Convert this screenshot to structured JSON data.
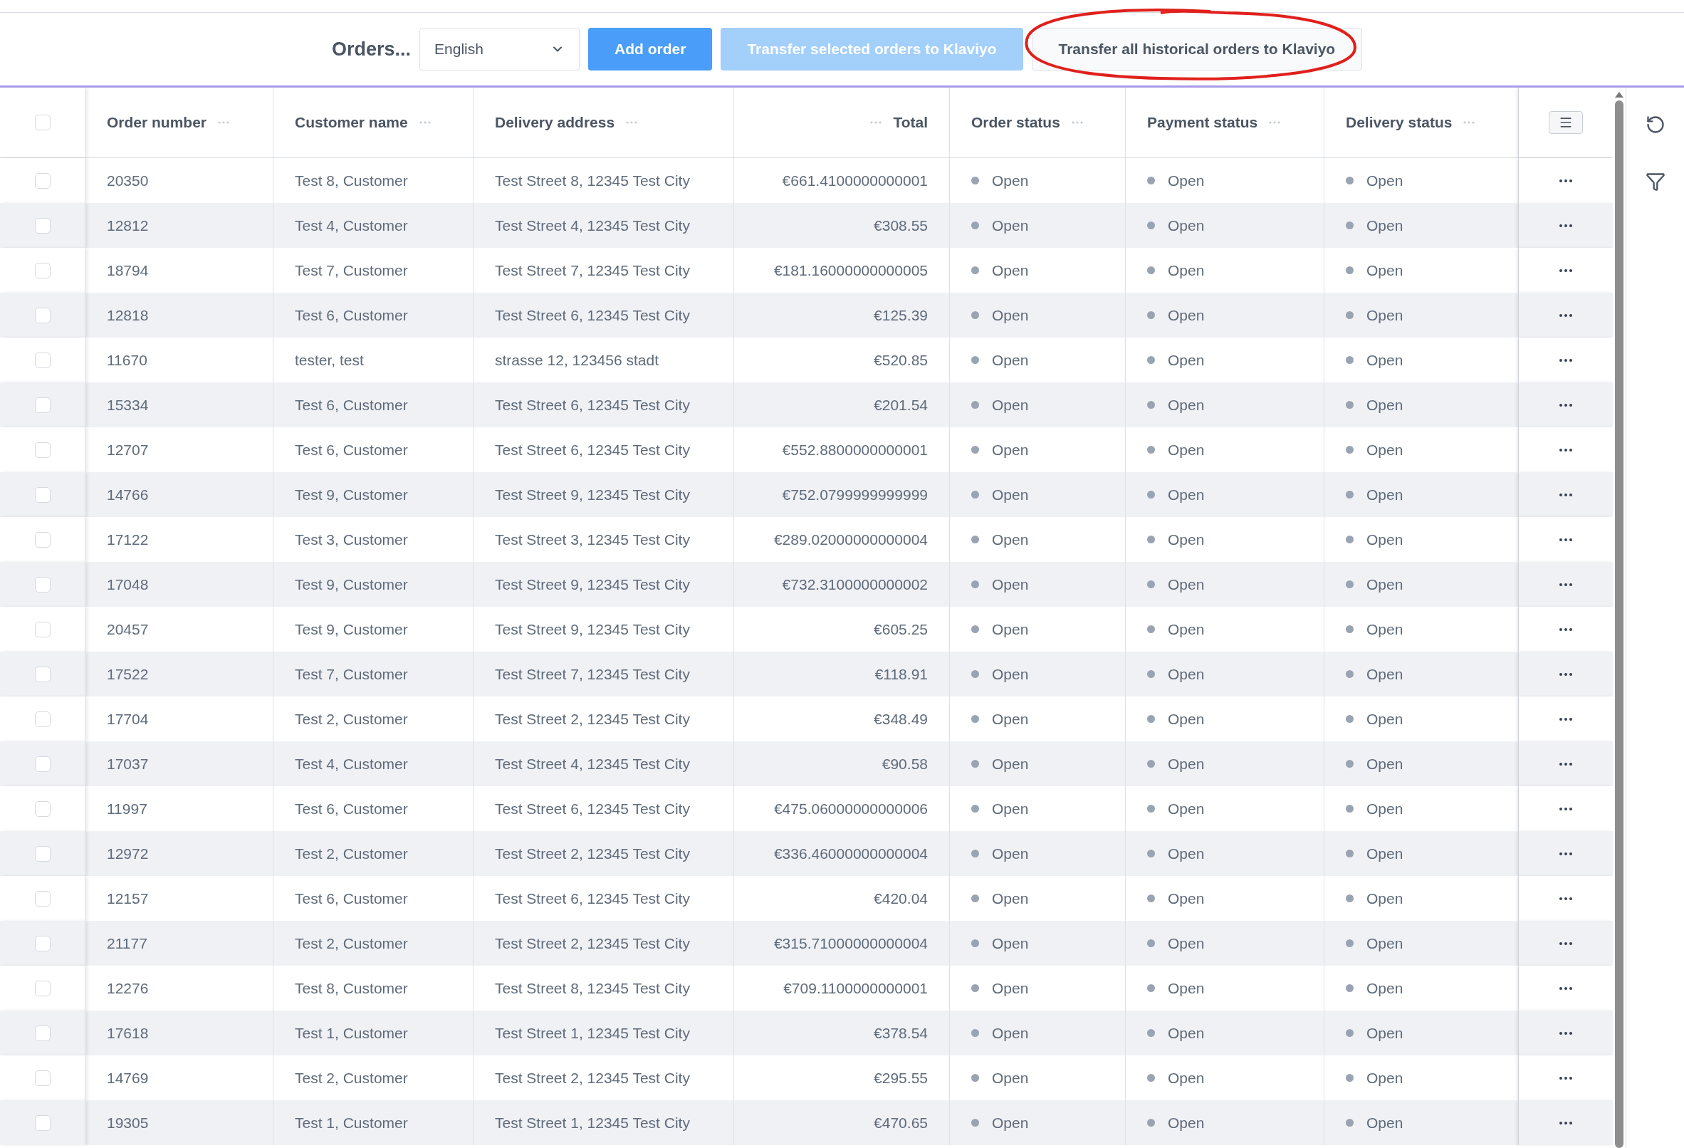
{
  "toolbar": {
    "title": "Orders...",
    "language_select": {
      "value": "English"
    },
    "buttons": [
      {
        "label": "Add order",
        "kind": "primary",
        "disabled": false
      },
      {
        "label": "Transfer selected orders to Klaviyo",
        "kind": "primary",
        "disabled": true
      },
      {
        "label": "Transfer all historical orders to Klaviyo",
        "kind": "secondary",
        "disabled": false
      }
    ]
  },
  "table": {
    "select_all": {
      "checked": false
    },
    "columns": [
      {
        "label": "Order number",
        "kind": "text"
      },
      {
        "label": "Customer name",
        "kind": "text"
      },
      {
        "label": "Delivery address",
        "kind": "text"
      },
      {
        "label": "Total",
        "kind": "amount"
      },
      {
        "label": "Order status",
        "kind": "status"
      },
      {
        "label": "Payment status",
        "kind": "status"
      },
      {
        "label": "Delivery status",
        "kind": "status"
      }
    ],
    "rows": [
      {
        "checked": false,
        "cells": [
          "20350",
          "Test 8, Customer",
          "Test Street 8, 12345 Test City",
          "€661.4100000000001",
          "Open",
          "Open",
          "Open"
        ]
      },
      {
        "checked": false,
        "cells": [
          "12812",
          "Test 4, Customer",
          "Test Street 4, 12345 Test City",
          "€308.55",
          "Open",
          "Open",
          "Open"
        ]
      },
      {
        "checked": false,
        "cells": [
          "18794",
          "Test 7, Customer",
          "Test Street 7, 12345 Test City",
          "€181.16000000000005",
          "Open",
          "Open",
          "Open"
        ]
      },
      {
        "checked": false,
        "cells": [
          "12818",
          "Test 6, Customer",
          "Test Street 6, 12345 Test City",
          "€125.39",
          "Open",
          "Open",
          "Open"
        ]
      },
      {
        "checked": false,
        "cells": [
          "11670",
          "tester, test",
          "strasse 12, 123456 stadt",
          "€520.85",
          "Open",
          "Open",
          "Open"
        ]
      },
      {
        "checked": false,
        "cells": [
          "15334",
          "Test 6, Customer",
          "Test Street 6, 12345 Test City",
          "€201.54",
          "Open",
          "Open",
          "Open"
        ]
      },
      {
        "checked": false,
        "cells": [
          "12707",
          "Test 6, Customer",
          "Test Street 6, 12345 Test City",
          "€552.8800000000001",
          "Open",
          "Open",
          "Open"
        ]
      },
      {
        "checked": false,
        "cells": [
          "14766",
          "Test 9, Customer",
          "Test Street 9, 12345 Test City",
          "€752.0799999999999",
          "Open",
          "Open",
          "Open"
        ]
      },
      {
        "checked": false,
        "cells": [
          "17122",
          "Test 3, Customer",
          "Test Street 3, 12345 Test City",
          "€289.02000000000004",
          "Open",
          "Open",
          "Open"
        ]
      },
      {
        "checked": false,
        "cells": [
          "17048",
          "Test 9, Customer",
          "Test Street 9, 12345 Test City",
          "€732.3100000000002",
          "Open",
          "Open",
          "Open"
        ]
      },
      {
        "checked": false,
        "cells": [
          "20457",
          "Test 9, Customer",
          "Test Street 9, 12345 Test City",
          "€605.25",
          "Open",
          "Open",
          "Open"
        ]
      },
      {
        "checked": false,
        "cells": [
          "17522",
          "Test 7, Customer",
          "Test Street 7, 12345 Test City",
          "€118.91",
          "Open",
          "Open",
          "Open"
        ]
      },
      {
        "checked": false,
        "cells": [
          "17704",
          "Test 2, Customer",
          "Test Street 2, 12345 Test City",
          "€348.49",
          "Open",
          "Open",
          "Open"
        ]
      },
      {
        "checked": false,
        "cells": [
          "17037",
          "Test 4, Customer",
          "Test Street 4, 12345 Test City",
          "€90.58",
          "Open",
          "Open",
          "Open"
        ]
      },
      {
        "checked": false,
        "cells": [
          "11997",
          "Test 6, Customer",
          "Test Street 6, 12345 Test City",
          "€475.06000000000006",
          "Open",
          "Open",
          "Open"
        ]
      },
      {
        "checked": false,
        "cells": [
          "12972",
          "Test 2, Customer",
          "Test Street 2, 12345 Test City",
          "€336.46000000000004",
          "Open",
          "Open",
          "Open"
        ]
      },
      {
        "checked": false,
        "cells": [
          "12157",
          "Test 6, Customer",
          "Test Street 6, 12345 Test City",
          "€420.04",
          "Open",
          "Open",
          "Open"
        ]
      },
      {
        "checked": false,
        "cells": [
          "21177",
          "Test 2, Customer",
          "Test Street 2, 12345 Test City",
          "€315.71000000000004",
          "Open",
          "Open",
          "Open"
        ]
      },
      {
        "checked": false,
        "cells": [
          "12276",
          "Test 8, Customer",
          "Test Street 8, 12345 Test City",
          "€709.1100000000001",
          "Open",
          "Open",
          "Open"
        ]
      },
      {
        "checked": false,
        "cells": [
          "17618",
          "Test 1, Customer",
          "Test Street 1, 12345 Test City",
          "€378.54",
          "Open",
          "Open",
          "Open"
        ]
      },
      {
        "checked": false,
        "cells": [
          "14769",
          "Test 2, Customer",
          "Test Street 2, 12345 Test City",
          "€295.55",
          "Open",
          "Open",
          "Open"
        ]
      },
      {
        "checked": false,
        "cells": [
          "19305",
          "Test 1, Customer",
          "Test Street 1, 12345 Test City",
          "€470.65",
          "Open",
          "Open",
          "Open"
        ]
      }
    ]
  }
}
